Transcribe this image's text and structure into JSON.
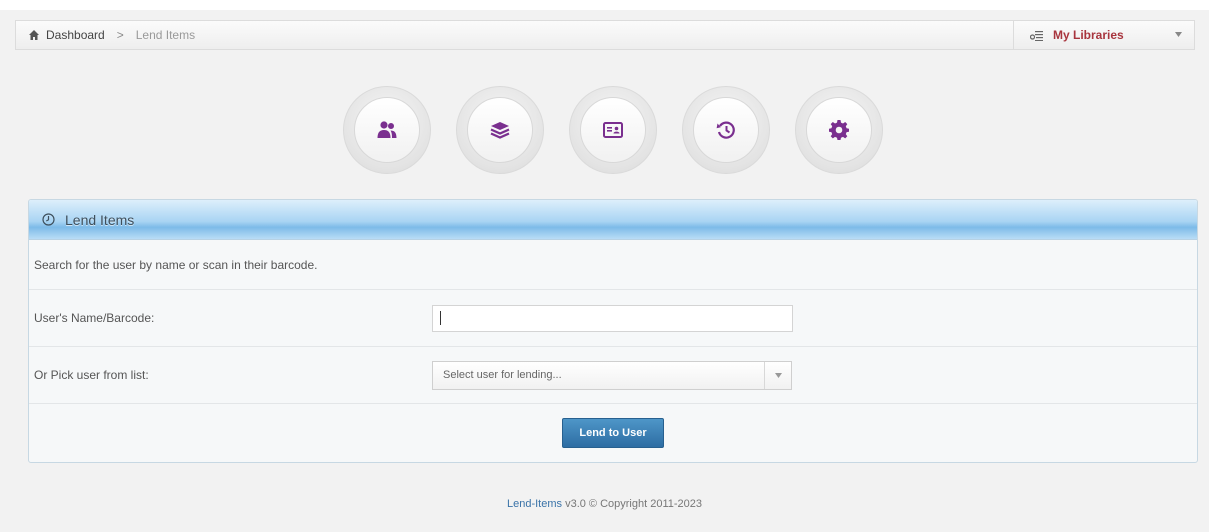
{
  "breadcrumb": {
    "home_icon": "home-icon",
    "items": [
      "Dashboard",
      "Lend Items"
    ],
    "separator": ">"
  },
  "libraries_menu": {
    "icon": "library-list-icon",
    "label": "My Libraries",
    "caret_icon": "chevron-down-icon",
    "label_color": "#a8353e"
  },
  "quick_nav": [
    {
      "icon": "users-icon"
    },
    {
      "icon": "layers-icon"
    },
    {
      "icon": "id-card-icon"
    },
    {
      "icon": "history-icon"
    },
    {
      "icon": "gear-icon"
    }
  ],
  "icon_color": "#7a2f8f",
  "panel": {
    "title_icon": "clock-icon",
    "title": "Lend Items",
    "intro": "Search for the user by name or scan in their barcode.",
    "name_field": {
      "label": "User's Name/Barcode:",
      "value": ""
    },
    "pick_field": {
      "label": "Or Pick user from list:",
      "placeholder": "Select user for lending..."
    },
    "submit_label": "Lend to User"
  },
  "footer": {
    "app_name": "Lend-Items",
    "text": " v3.0 © Copyright 2011-2023"
  }
}
